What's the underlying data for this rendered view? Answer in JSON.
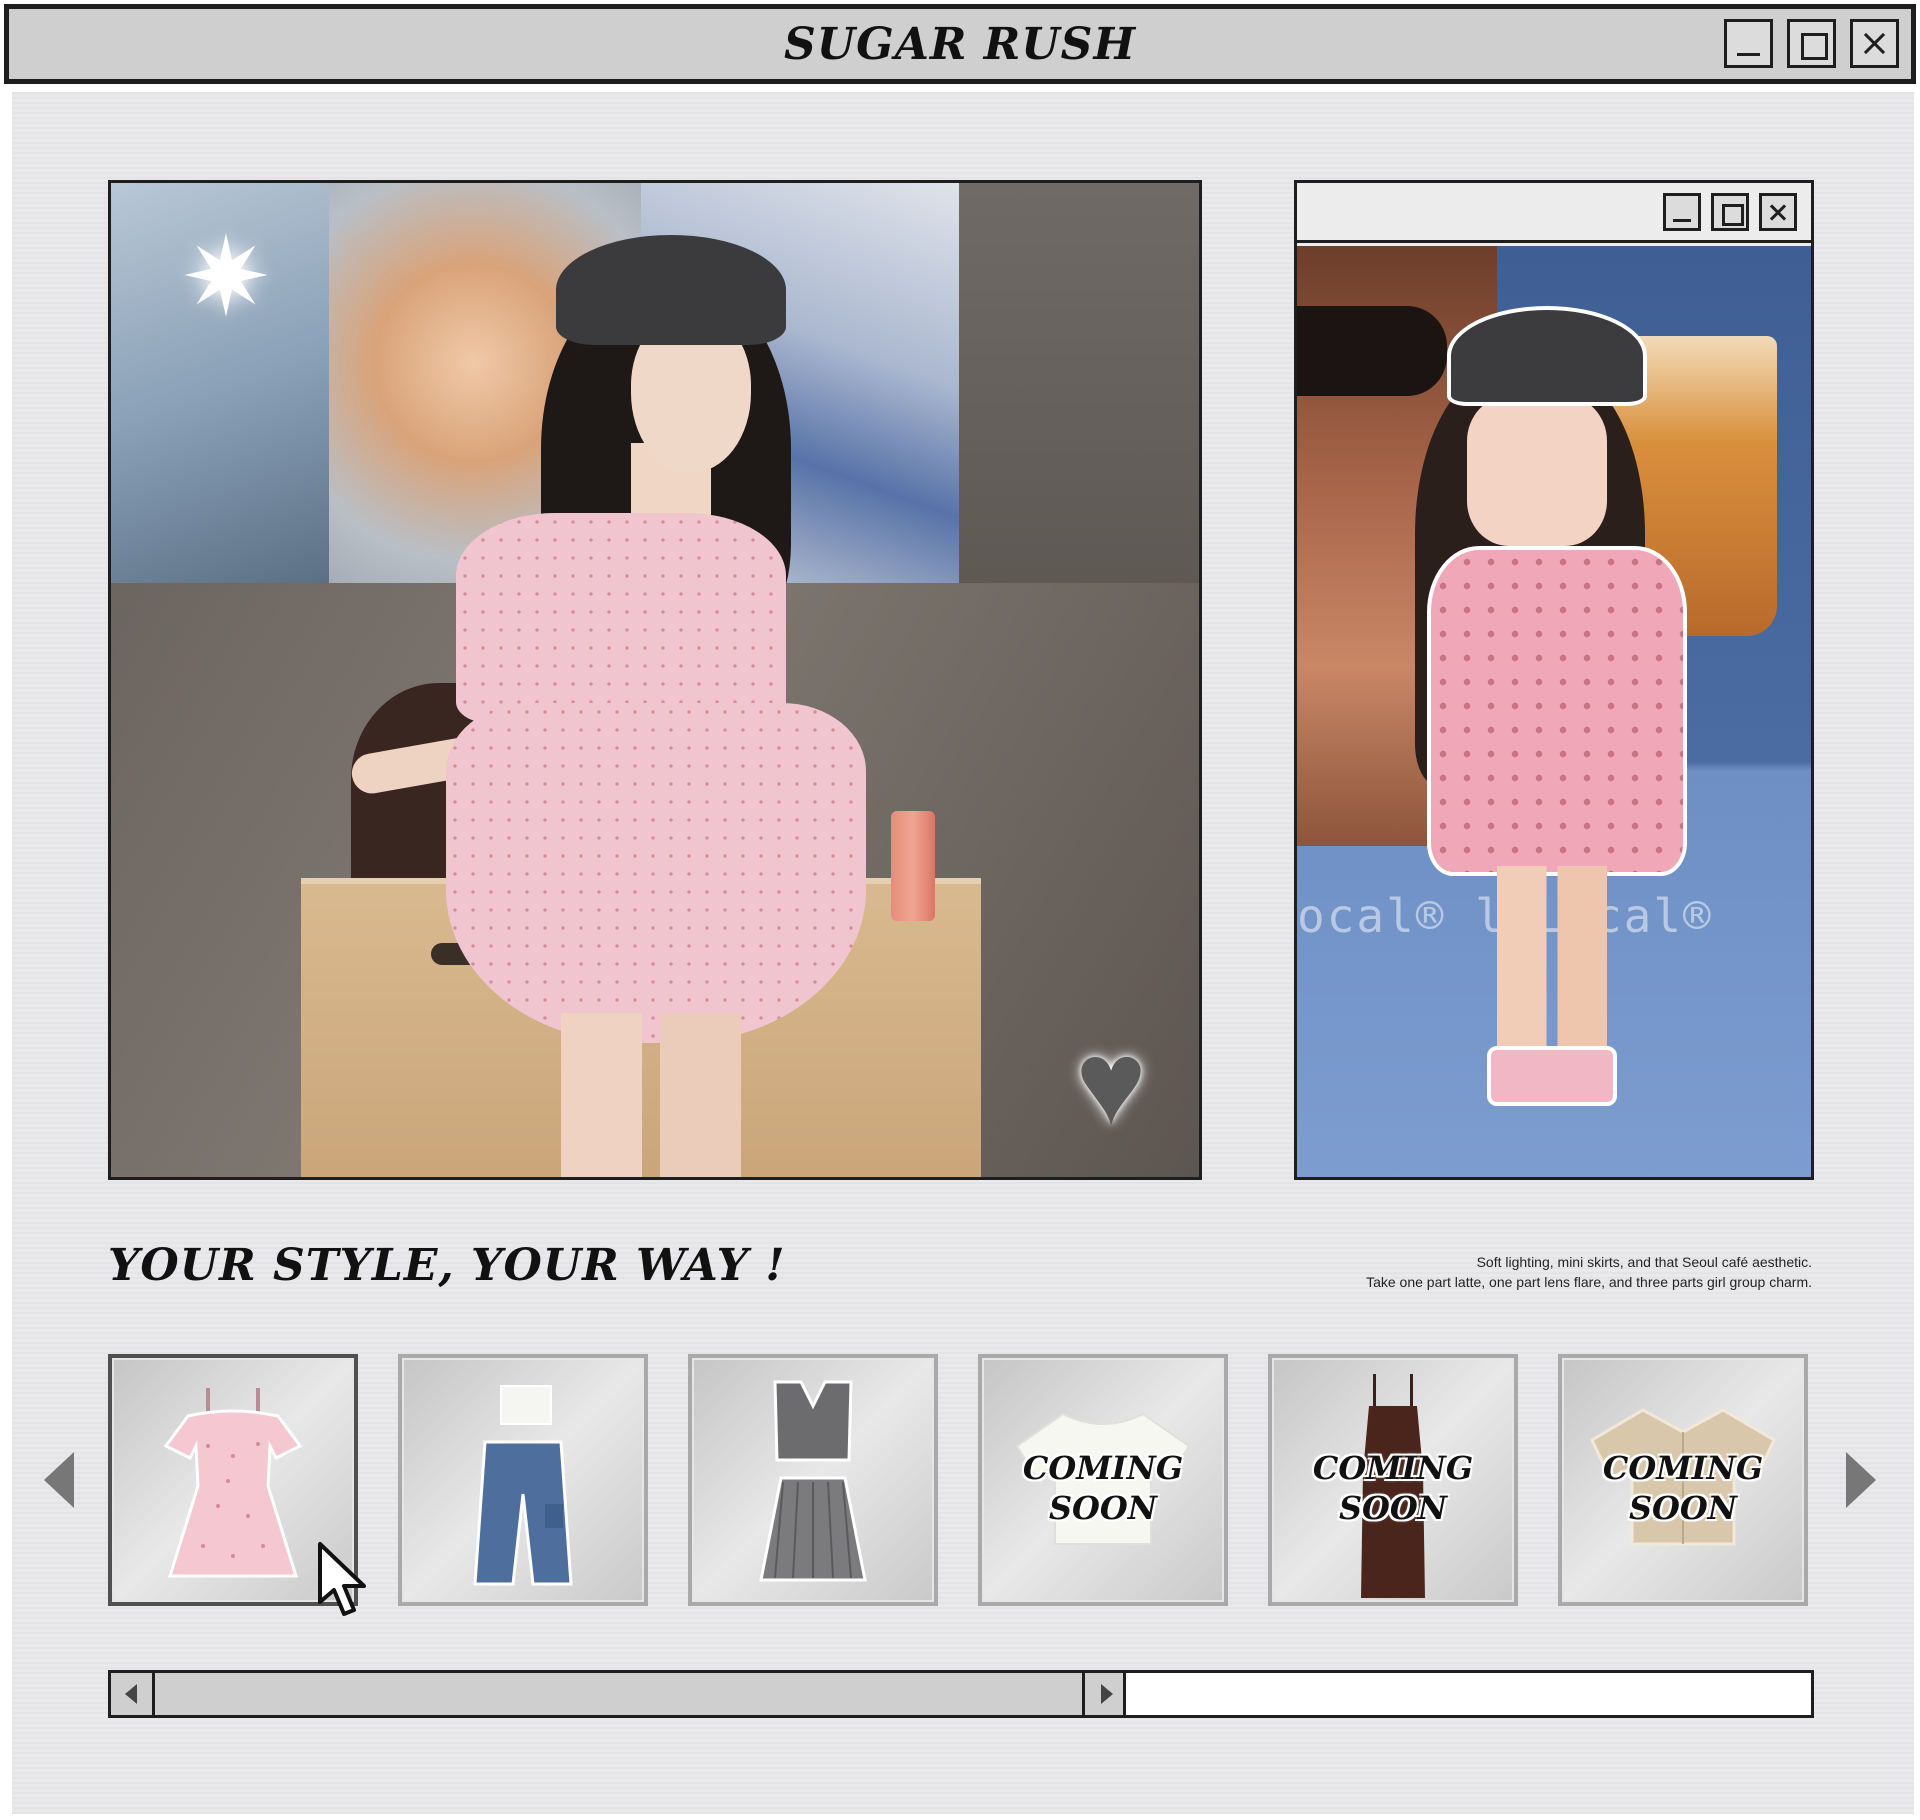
{
  "window": {
    "title": "SUGAR RUSH",
    "controls": [
      "minimize-icon",
      "maximize-icon",
      "close-icon"
    ]
  },
  "hero": {
    "photo_icons": [
      "sparkle-icon",
      "heart-icon"
    ],
    "pixel_art_overlay_text": "ocal®    l Local®"
  },
  "section": {
    "headline": "YOUR STYLE, YOUR WAY !",
    "tagline_line1": "Soft lighting, mini skirts, and that Seoul café aesthetic.",
    "tagline_line2": "Take one part latte, one part lens flare, and three parts girl group charm."
  },
  "carousel": {
    "items": [
      {
        "garment": "pink-floral-dress",
        "label": "",
        "selected": true
      },
      {
        "garment": "white-top-and-cargo-jeans",
        "label": ""
      },
      {
        "garment": "grey-vest-and-pleated-skirt",
        "label": ""
      },
      {
        "garment": "white-tee",
        "label_line1": "COMING",
        "label_line2": "SOON"
      },
      {
        "garment": "brown-slip-dress",
        "label_line1": "COMING",
        "label_line2": "SOON"
      },
      {
        "garment": "beige-shirt",
        "label_line1": "COMING",
        "label_line2": "SOON"
      }
    ]
  },
  "scrollbar": {
    "position_fraction": 0.0,
    "visible_fraction": 0.6
  },
  "colors": {
    "background": "#e9e9eb",
    "titlebar": "#cfcfcf",
    "border": "#1e1e1e",
    "accent_pink": "#f1c5cf"
  }
}
